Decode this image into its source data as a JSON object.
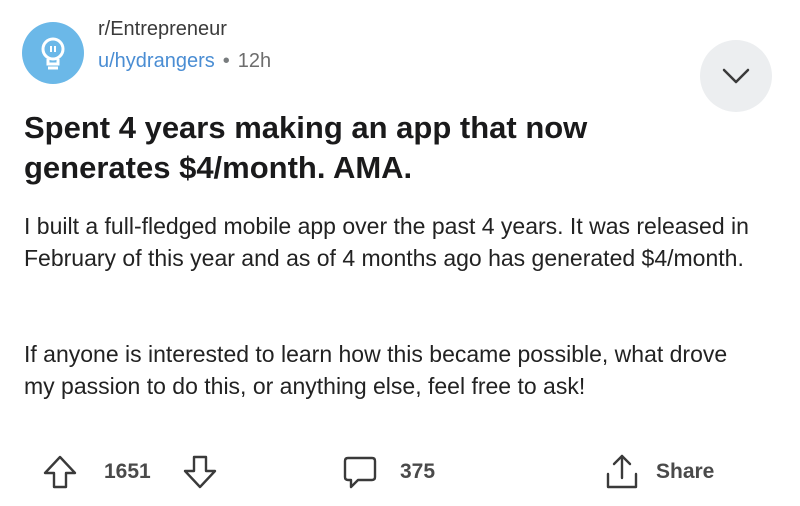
{
  "post": {
    "subreddit": "r/Entrepreneur",
    "username": "u/hydrangers",
    "separator": "•",
    "time": "12h",
    "title": "Spent 4 years making an app that now generates $4/month. AMA.",
    "body": [
      "I built a full-fledged mobile app over the past 4 years. It was released in February of this year and as of 4 months ago has generated $4/month.",
      "If anyone is interested to learn how this became possible, what drove my passion to do this, or anything else, feel free to ask!"
    ]
  },
  "actions": {
    "votes": "1651",
    "comments": "375",
    "share_label": "Share"
  },
  "colors": {
    "avatar": "#6bb8e8",
    "username": "#4a8dd3",
    "chevron_bg": "#eceef0"
  },
  "icons": {
    "avatar": "lightbulb-icon",
    "expand": "chevron-down-icon",
    "upvote": "arrow-up-icon",
    "downvote": "arrow-down-icon",
    "comments": "speech-bubble-icon",
    "share": "share-icon"
  }
}
